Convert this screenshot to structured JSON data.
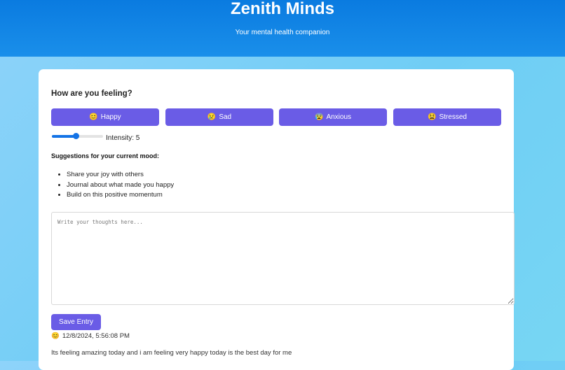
{
  "app": {
    "title": "Zenith Minds",
    "subtitle": "Your mental health companion"
  },
  "mood": {
    "question": "How are you feeling?",
    "options": [
      {
        "emoji": "😊",
        "label": "Happy"
      },
      {
        "emoji": "😢",
        "label": "Sad"
      },
      {
        "emoji": "😰",
        "label": "Anxious"
      },
      {
        "emoji": "😫",
        "label": "Stressed"
      }
    ],
    "intensity_label": "Intensity: 5",
    "intensity_value": 5,
    "intensity_max": 10
  },
  "suggestions": {
    "title": "Suggestions for your current mood:",
    "items": [
      "Share your joy with others",
      "Journal about what made you happy",
      "Build on this positive momentum"
    ]
  },
  "journal": {
    "placeholder": "Write your thoughts here...",
    "value": ""
  },
  "save_label": "Save Entry",
  "entry": {
    "emoji": "😊",
    "timestamp": "12/8/2024, 5:56:08 PM",
    "text": "Its feeling amazing today and i am feeling very happy today is the best day for me"
  },
  "colors": {
    "header": "#0a7be0",
    "button": "#6a5ce6",
    "slider": "#1473e6"
  }
}
